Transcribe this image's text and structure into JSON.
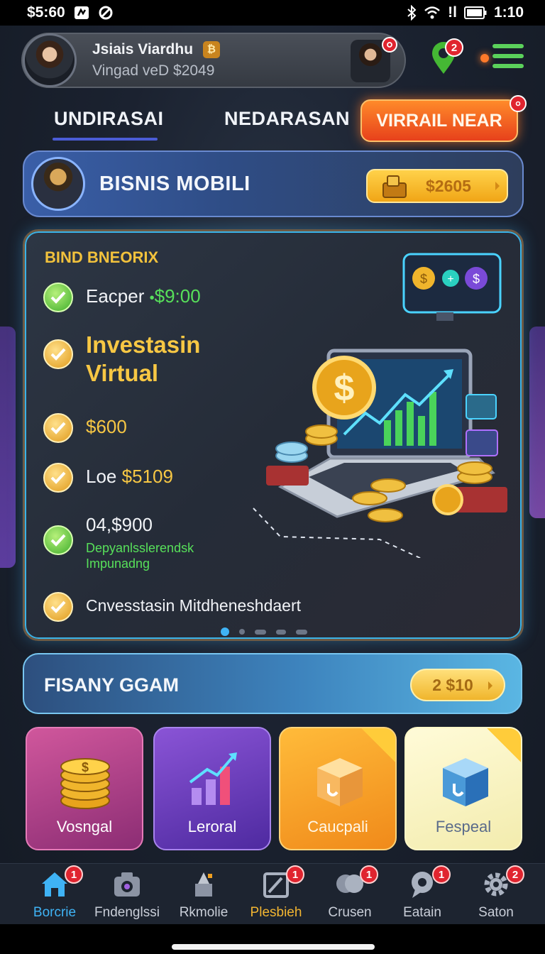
{
  "status_bar": {
    "time": "$5:60",
    "clock_right": "1:10",
    "signal_text": "!l"
  },
  "header": {
    "user_name": "Jsiais Viardhu",
    "user_balance": "Vingad veD $2049",
    "gold_badge": "₿",
    "avatar_badge_count": "",
    "pin_badge_count": "2"
  },
  "tabs": [
    {
      "label": "UNDIRASAI"
    },
    {
      "label": "NEDARASAN"
    },
    {
      "label": "VIRRAIL NEAR"
    }
  ],
  "tab_badge": "",
  "business": {
    "title": "BISNIS MOBILI",
    "amount": "$2605"
  },
  "feature": {
    "label": "BIND BNEORIX",
    "items": [
      {
        "text": "Eacper",
        "value": "$9:00",
        "check": "green"
      },
      {
        "text": "Investasin Virtual",
        "check": "gold"
      },
      {
        "text": "$600",
        "check": "gold"
      },
      {
        "text": "Loe",
        "value": "$5109",
        "check": "gold"
      },
      {
        "text": "04,$900",
        "sub": "Depyanlsslerendsk Impunadng",
        "check": "green"
      },
      {
        "text": "Cnvesstasin Mitdheneshdaert",
        "check": "gold"
      }
    ]
  },
  "game": {
    "title": "FISANY GGAM",
    "amount": "2 $10"
  },
  "tiles": [
    {
      "label": "Vosngal",
      "icon": "coin-stack-icon"
    },
    {
      "label": "Leroral",
      "icon": "growth-chart-icon"
    },
    {
      "label": "Caucpali",
      "icon": "box-icon"
    },
    {
      "label": "Fespeal",
      "icon": "cube-icon"
    }
  ],
  "nav": [
    {
      "label": "Borcrie",
      "icon": "home-icon",
      "badge": "1"
    },
    {
      "label": "Fndenglssi",
      "icon": "camera-icon",
      "badge": ""
    },
    {
      "label": "Rkmolie",
      "icon": "rocket-icon",
      "badge": ""
    },
    {
      "label": "Plesbieh",
      "icon": "edit-icon",
      "badge": "1"
    },
    {
      "label": "Crusen",
      "icon": "chat-icon",
      "badge": "1"
    },
    {
      "label": "Eatain",
      "icon": "message-icon",
      "badge": "1"
    },
    {
      "label": "Saton",
      "icon": "gear-icon",
      "badge": "2"
    }
  ],
  "colors": {
    "accent_orange": "#e7411b",
    "accent_gold": "#f7c744",
    "accent_blue": "#3fb3f5",
    "badge_red": "#e0242f"
  }
}
